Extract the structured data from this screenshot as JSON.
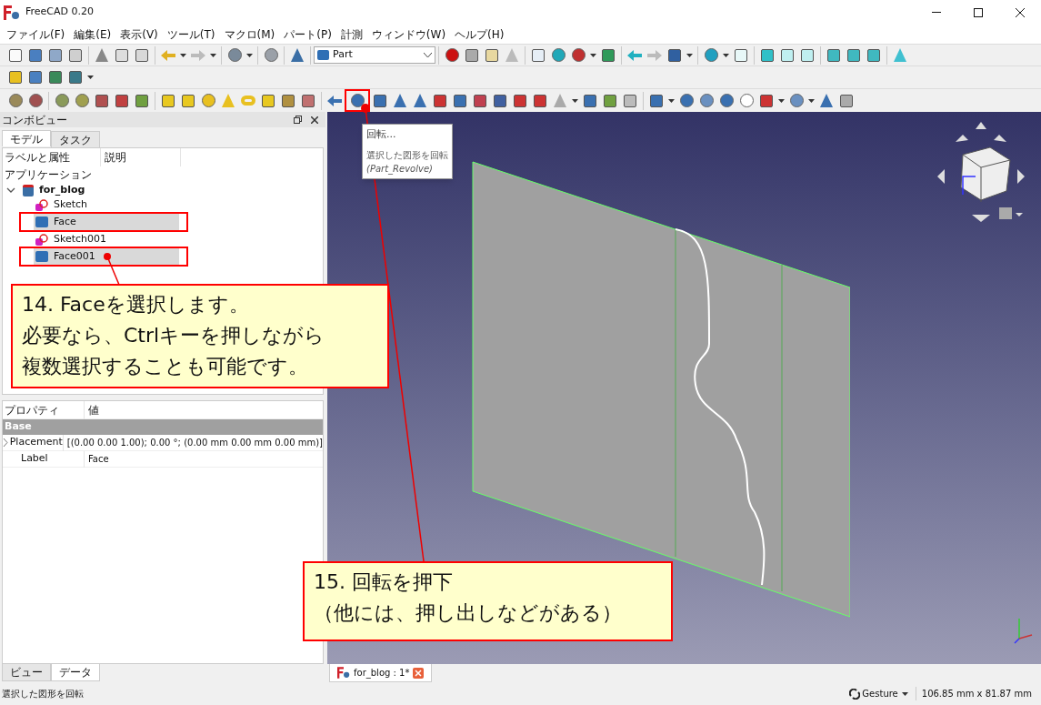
{
  "window": {
    "title": "FreeCAD 0.20"
  },
  "menu": [
    "ファイル(F)",
    "編集(E)",
    "表示(V)",
    "ツール(T)",
    "マクロ(M)",
    "パート(P)",
    "計測",
    "ウィンドウ(W)",
    "ヘルプ(H)"
  ],
  "workbench": {
    "value": "Part"
  },
  "combo_view": {
    "title": "コンボビュー",
    "tabs": [
      {
        "label": "モデル",
        "selected": true
      },
      {
        "label": "タスク",
        "selected": false
      }
    ],
    "tree": {
      "columns": [
        "ラベルと属性",
        "説明"
      ],
      "section": "アプリケーション",
      "items": [
        {
          "label": "for_blog",
          "kind": "document",
          "expanded": true,
          "selected": false,
          "children": [
            {
              "label": "Sketch",
              "kind": "sketch",
              "selected": false,
              "highlighted": false
            },
            {
              "label": "Face",
              "kind": "solid",
              "selected": true,
              "highlighted": true
            },
            {
              "label": "Sketch001",
              "kind": "sketch",
              "selected": false,
              "highlighted": false
            },
            {
              "label": "Face001",
              "kind": "solid",
              "selected": true,
              "highlighted": true
            }
          ]
        }
      ]
    },
    "properties": {
      "columns": [
        "プロパティ",
        "値"
      ],
      "groups": [
        {
          "name": "Base",
          "rows": [
            {
              "name": "Placement",
              "value": "[(0.00 0.00 1.00); 0.00 °; (0.00 mm  0.00 mm  0.00 mm)]",
              "expanded": false
            },
            {
              "name": "Label",
              "value": "Face"
            }
          ]
        }
      ]
    },
    "bottom_tabs": [
      {
        "label": "ビュー",
        "selected": false
      },
      {
        "label": "データ",
        "selected": true
      }
    ]
  },
  "tooltip": {
    "title": "回転...",
    "description": "選択した図形を回転",
    "command": "(Part_Revolve)"
  },
  "callouts": [
    {
      "lines": [
        "14. Faceを選択します。",
        "必要なら、Ctrlキーを押しながら",
        "複数選択することも可能です。"
      ]
    },
    {
      "lines": [
        "15. 回転を押下",
        "（他には、押し出しなどがある）"
      ]
    }
  ],
  "document_tab": {
    "label": "for_blog : 1*"
  },
  "status_bar": {
    "message": "選択した図形を回転",
    "navigation": "Gesture",
    "dimensions": "106.85 mm x 81.87 mm"
  }
}
